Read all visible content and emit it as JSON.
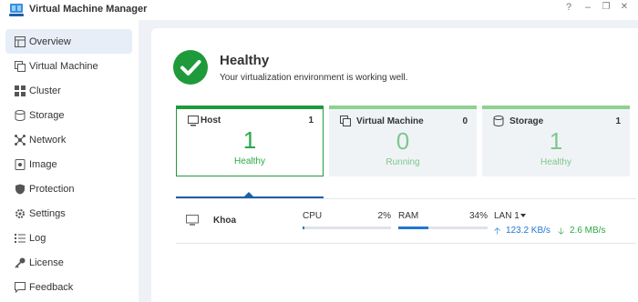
{
  "window": {
    "title": "Virtual Machine Manager",
    "help": "?",
    "minimize": "–",
    "restore": "❐",
    "close": "✕"
  },
  "sidebar": {
    "items": [
      {
        "label": "Overview",
        "icon": "overview-icon",
        "active": true
      },
      {
        "label": "Virtual Machine",
        "icon": "virtual-machine-icon"
      },
      {
        "label": "Cluster",
        "icon": "cluster-icon"
      },
      {
        "label": "Storage",
        "icon": "storage-icon"
      },
      {
        "label": "Network",
        "icon": "network-icon"
      },
      {
        "label": "Image",
        "icon": "image-icon"
      },
      {
        "label": "Protection",
        "icon": "shield-icon"
      },
      {
        "label": "Settings",
        "icon": "gear-icon"
      },
      {
        "label": "Log",
        "icon": "log-icon"
      },
      {
        "label": "License",
        "icon": "key-icon"
      },
      {
        "label": "Feedback",
        "icon": "feedback-icon"
      }
    ]
  },
  "health": {
    "title": "Healthy",
    "description": "Your virtualization environment is working well.",
    "color": "#1f9a3a"
  },
  "cards": [
    {
      "label": "Host",
      "count": "1",
      "value": "1",
      "status": "Healthy"
    },
    {
      "label": "Virtual Machine",
      "count": "0",
      "value": "0",
      "status": "Running"
    },
    {
      "label": "Storage",
      "count": "1",
      "value": "1",
      "status": "Healthy"
    }
  ],
  "host_row": {
    "name": "Khoa",
    "cpu_label": "CPU",
    "cpu_value": "2%",
    "cpu_fraction": 0.02,
    "ram_label": "RAM",
    "ram_value": "34%",
    "ram_fraction": 0.34,
    "lan_label": "LAN 1",
    "upload": "123.2 KB/s",
    "download": "2.6 MB/s"
  },
  "colors": {
    "accent": "#1f78d1",
    "success": "#2aa84a",
    "active_nav": "#e7eef8"
  }
}
